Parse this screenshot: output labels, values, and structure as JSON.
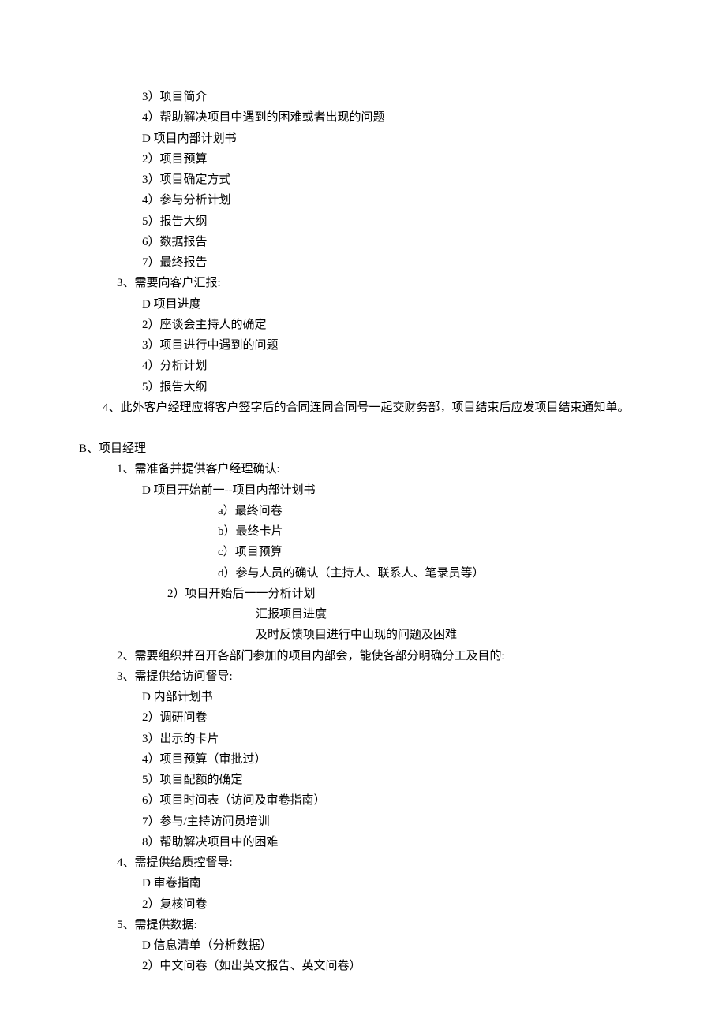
{
  "lines": [
    {
      "cls": "l1",
      "text": "3）项目简介"
    },
    {
      "cls": "l1",
      "text": "4）帮助解决项目中遇到的困难或者出现的问题"
    },
    {
      "cls": "l1",
      "text": "D 项目内部计划书"
    },
    {
      "cls": "l1",
      "text": "2）项目预算"
    },
    {
      "cls": "l1",
      "text": "3）项目确定方式"
    },
    {
      "cls": "l1",
      "text": "4）参与分析计划"
    },
    {
      "cls": "l1",
      "text": "5）报告大纲"
    },
    {
      "cls": "l1",
      "text": "6）数据报告"
    },
    {
      "cls": "l1",
      "text": "7）最终报告"
    },
    {
      "cls": "lb",
      "text": "3、需要向客户汇报:"
    },
    {
      "cls": "l1",
      "text": "D 项目进度"
    },
    {
      "cls": "l1",
      "text": "2）座谈会主持人的确定"
    },
    {
      "cls": "l1",
      "text": "3）项目进行中遇到的问题"
    },
    {
      "cls": "l1",
      "text": "4）分析计划"
    },
    {
      "cls": "l1",
      "text": "5）报告大纲"
    },
    {
      "cls": "wrap",
      "text": "　　4、此外客户经理应将客户签字后的合同连同合同号一起交财务部，项目结束后应发项目结束通知单。"
    },
    {
      "cls": "spacer",
      "text": ""
    },
    {
      "cls": "l0",
      "text": "B、项目经理"
    },
    {
      "cls": "lb",
      "text": "1、需准备并提供客户经理确认:"
    },
    {
      "cls": "l1",
      "text": "D 项目开始前一--项目内部计划书"
    },
    {
      "cls": "l3",
      "text": "a）最终问卷"
    },
    {
      "cls": "l3",
      "text": "b）最终卡片"
    },
    {
      "cls": "l3",
      "text": "c）项目预算"
    },
    {
      "cls": "l3",
      "text": "d）参与人员的确认（主持人、联系人、笔录员等）"
    },
    {
      "cls": "l2",
      "text": "2）项目开始后一一分析计划"
    },
    {
      "cls": "l4",
      "text": "汇报项目进度"
    },
    {
      "cls": "l4",
      "text": "及时反馈项目进行中山现的问题及困难"
    },
    {
      "cls": "lb",
      "text": "2、需要组织并召开各部门参加的项目内部会，能使各部分明确分工及目的:"
    },
    {
      "cls": "lb",
      "text": "3、需提供给访问督导:"
    },
    {
      "cls": "l1",
      "text": "D 内部计划书"
    },
    {
      "cls": "l1",
      "text": "2）调研问卷"
    },
    {
      "cls": "l1",
      "text": "3）出示的卡片"
    },
    {
      "cls": "l1",
      "text": "4）项目预算（审批过）"
    },
    {
      "cls": "l1",
      "text": "5）项目配额的确定"
    },
    {
      "cls": "l1",
      "text": "6）项目时间表（访问及审卷指南）"
    },
    {
      "cls": "l1",
      "text": "7）参与/主持访问员培训"
    },
    {
      "cls": "l1",
      "text": "8）帮助解决项目中的困难"
    },
    {
      "cls": "lb",
      "text": "4、需提供给质控督导:"
    },
    {
      "cls": "l1",
      "text": "D 审卷指南"
    },
    {
      "cls": "l1",
      "text": "2）复核问卷"
    },
    {
      "cls": "lb",
      "text": "5、需提供数据:"
    },
    {
      "cls": "l1",
      "text": "D 信息清单（分析数据）"
    },
    {
      "cls": "l1",
      "text": "2）中文问卷（如出英文报告、英文问卷）"
    }
  ]
}
